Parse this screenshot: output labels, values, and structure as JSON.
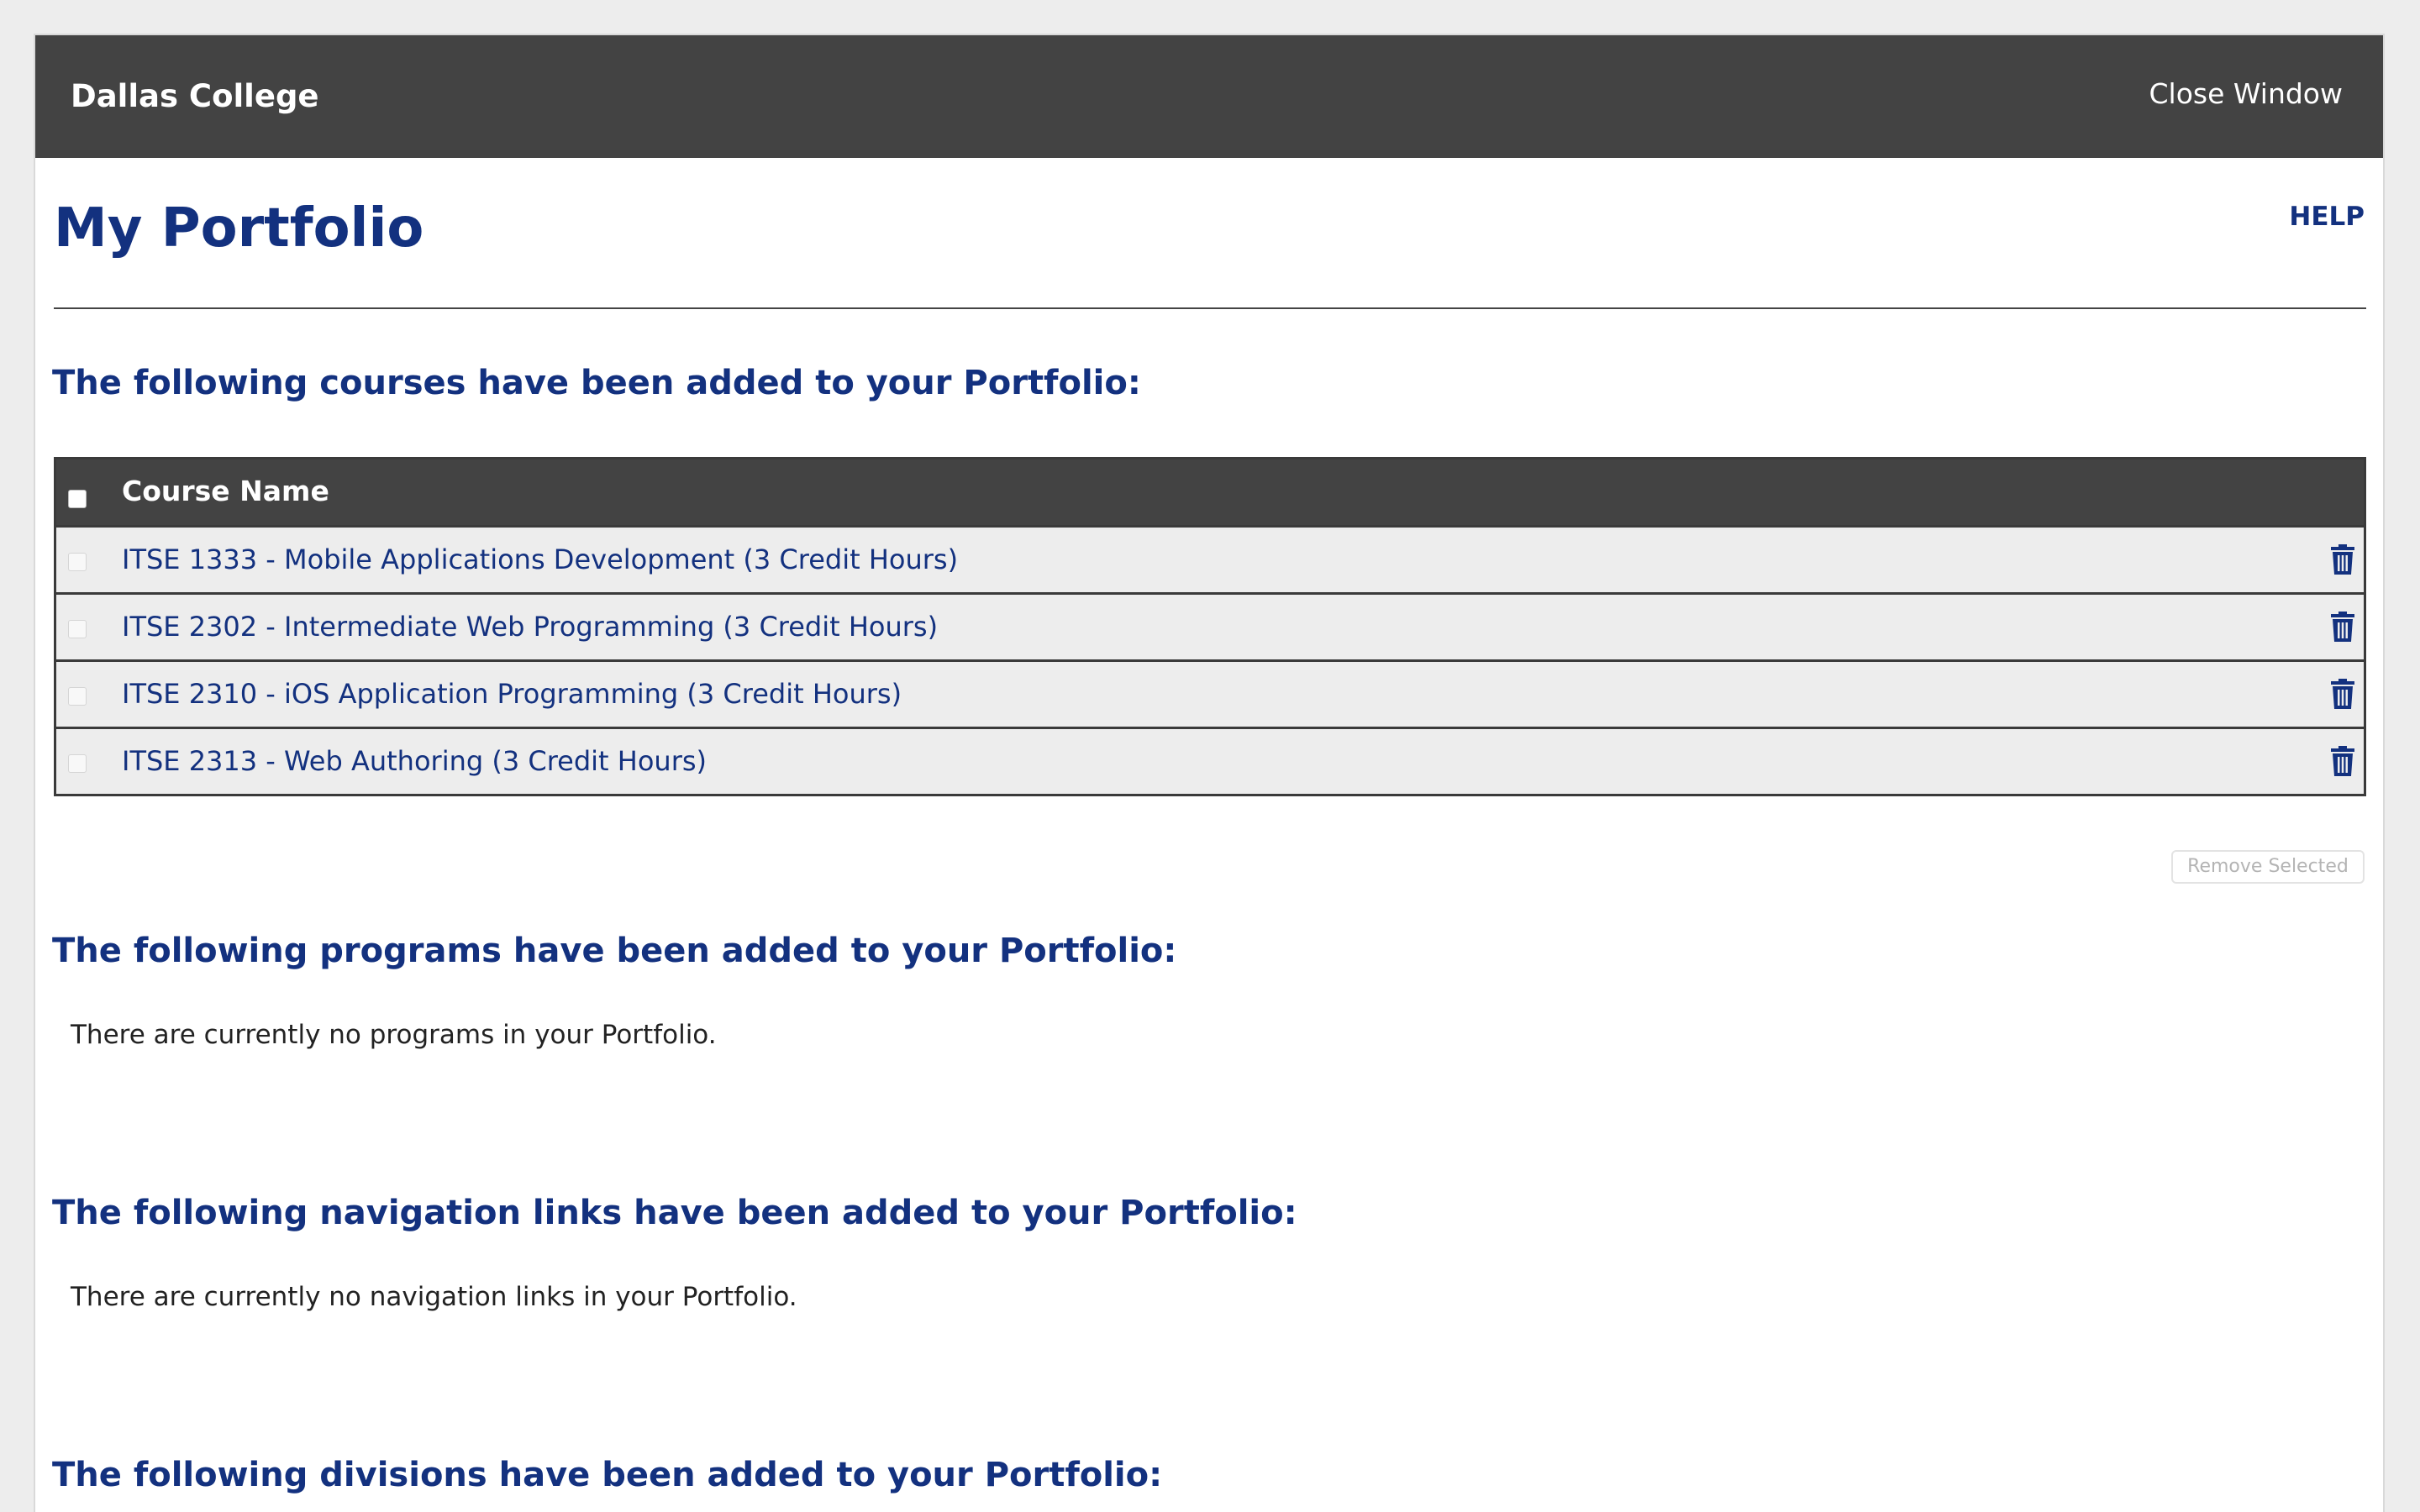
{
  "header": {
    "brand": "Dallas College",
    "close_label": "Close Window"
  },
  "page": {
    "title": "My Portfolio",
    "help_label": "HELP"
  },
  "courses_section": {
    "heading": "The following courses have been added to your Portfolio:",
    "column_header": "Course Name",
    "rows": [
      {
        "label": "ITSE 1333 - Mobile Applications Development (3 Credit Hours)"
      },
      {
        "label": "ITSE 2302 - Intermediate Web Programming (3 Credit Hours)"
      },
      {
        "label": "ITSE 2310 - iOS Application Programming (3 Credit Hours)"
      },
      {
        "label": "ITSE 2313 - Web Authoring (3 Credit Hours)"
      }
    ],
    "remove_selected_label": "Remove Selected"
  },
  "programs_section": {
    "heading": "The following programs have been added to your Portfolio:",
    "empty_message": "There are currently no programs in your Portfolio."
  },
  "navigation_section": {
    "heading": "The following navigation links have been added to your Portfolio:",
    "empty_message": "There are currently no navigation links in your Portfolio."
  },
  "divisions_section": {
    "heading": "The following divisions have been added to your Portfolio:"
  },
  "icons": {
    "row_delete": "trash-icon"
  },
  "colors": {
    "header_bg": "#434343",
    "heading_blue": "#13317f",
    "row_bg": "#ededed"
  }
}
